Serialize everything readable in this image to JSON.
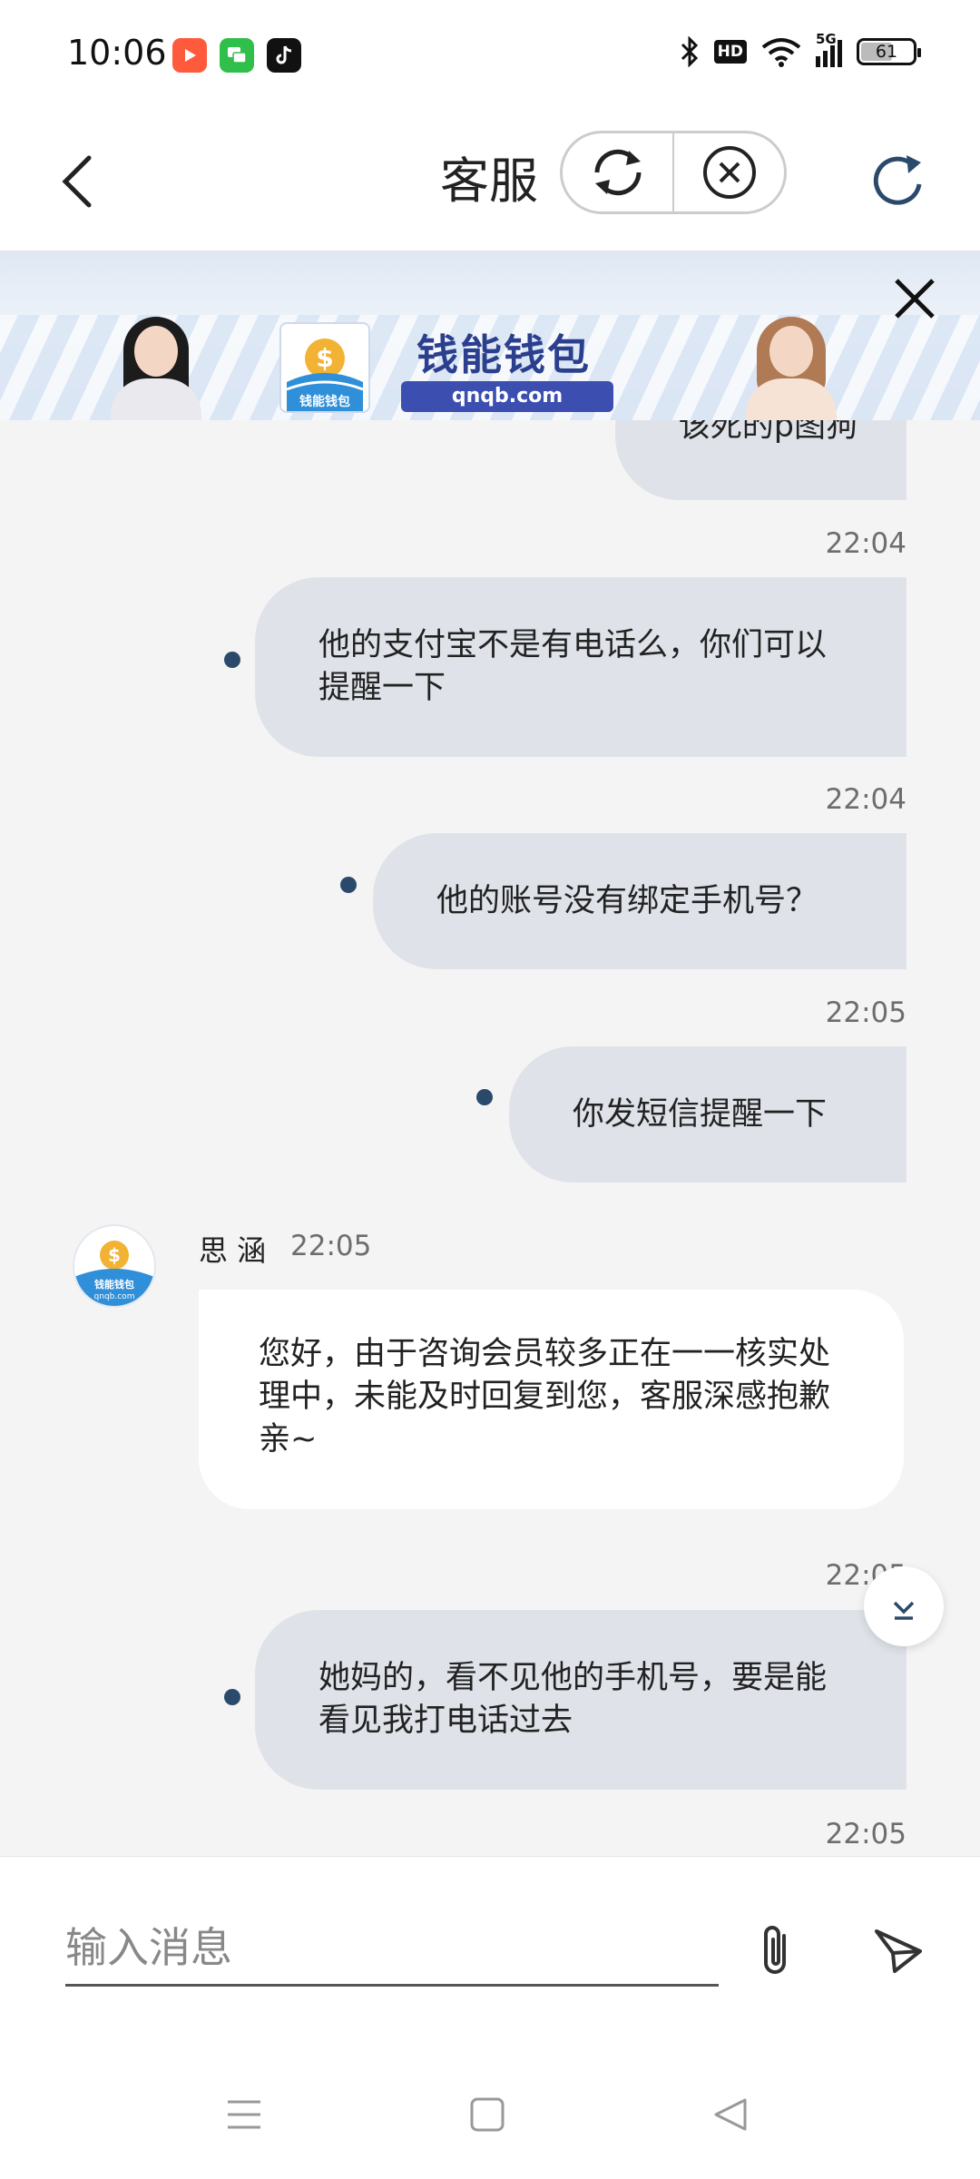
{
  "status_bar": {
    "time": "10:06",
    "battery_level": "61",
    "network": "5G",
    "hd_badge": "HD",
    "app_icons": [
      "video-app-icon",
      "messages-app-icon",
      "tiktok-app-icon"
    ],
    "system_icons": [
      "bluetooth-icon",
      "hd-icon",
      "wifi-icon",
      "signal-icon",
      "battery-icon"
    ]
  },
  "header": {
    "title": "客服",
    "icons": [
      "back-arrow-icon",
      "sync-icon",
      "close-circle-icon",
      "refresh-icon"
    ]
  },
  "banner": {
    "brand_name": "钱能钱包",
    "brand_url": "qnqb.com",
    "logo_text": "钱能钱包",
    "close_icon": "close-icon"
  },
  "chat": {
    "messages": [
      {
        "direction": "out",
        "time": "",
        "text": "该死的p图狗"
      },
      {
        "direction": "out",
        "time": "22:04",
        "text": "他的支付宝不是有电话么，你们可以提醒一下"
      },
      {
        "direction": "out",
        "time": "22:04",
        "text": "他的账号没有绑定手机号？"
      },
      {
        "direction": "out",
        "time": "22:05",
        "text": "你发短信提醒一下"
      },
      {
        "direction": "in",
        "sender": "思 涵",
        "time": "22:05",
        "text": "您好，由于咨询会员较多正在一一核实处理中，未能及时回复到您，客服深感抱歉亲~"
      },
      {
        "direction": "out",
        "time": "22:05",
        "text": "她妈的，看不见他的手机号，要是能看见我打电话过去"
      },
      {
        "direction": "out",
        "time": "22:05",
        "text": ""
      }
    ],
    "agent_avatar_text": "钱能钱包",
    "agent_avatar_url": "qnqb.com",
    "scroll_down_icon": "chevron-down-icon"
  },
  "input": {
    "placeholder": "输入消息",
    "value": "",
    "attach_icon": "paperclip-icon",
    "send_icon": "send-icon"
  },
  "nav": {
    "icons": [
      "menu-icon",
      "home-icon",
      "back-icon"
    ]
  },
  "colors": {
    "outgoing_bubble": "#dfe3e9",
    "incoming_bubble": "#ffffff",
    "chat_background": "#f4f4f4",
    "brand_blue": "#2b3f8f",
    "status_dot": "#2b4a6b"
  }
}
